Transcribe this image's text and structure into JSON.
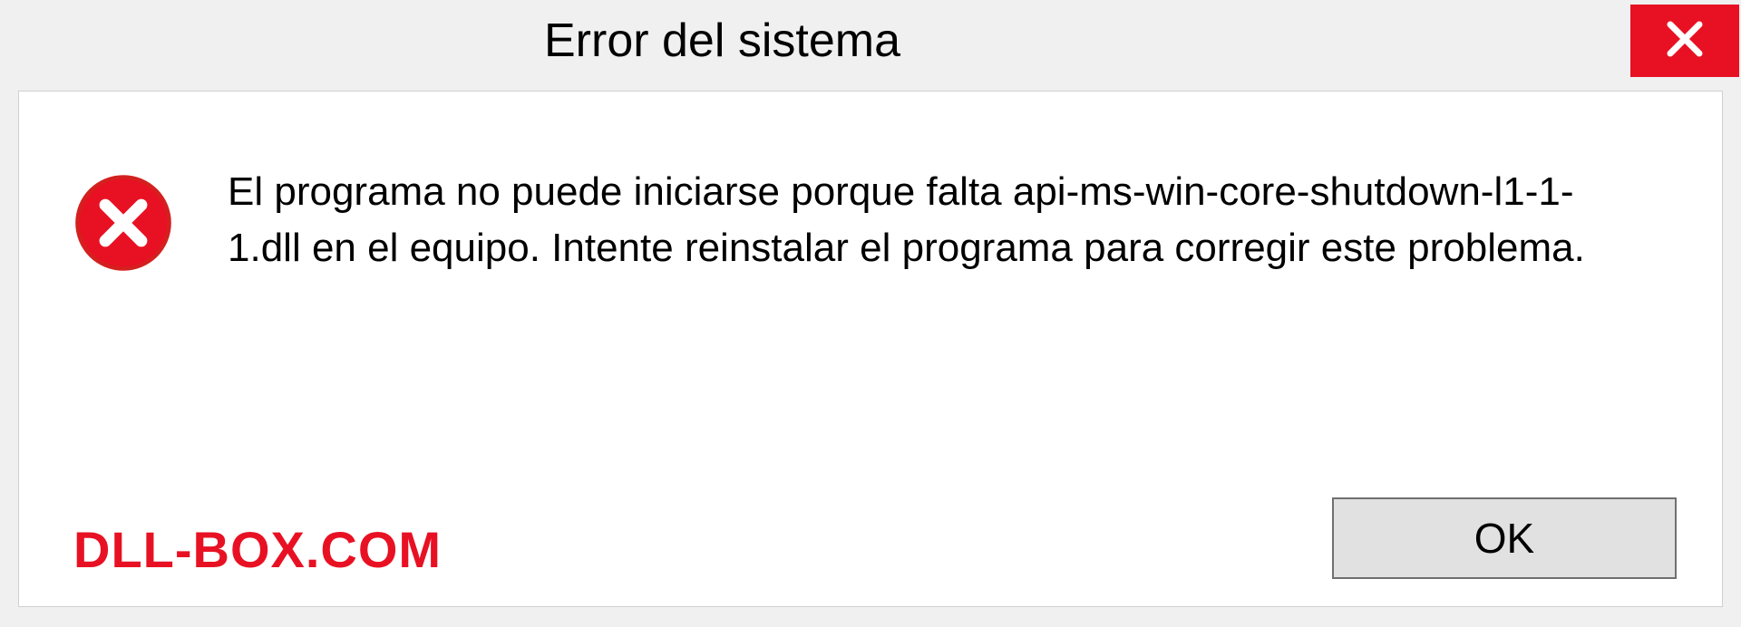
{
  "titlebar": {
    "title": "Error del sistema"
  },
  "message": {
    "text": "El programa no puede iniciarse porque falta api-ms-win-core-shutdown-l1-1-1.dll en el equipo. Intente reinstalar el programa para corregir este problema."
  },
  "buttons": {
    "ok_label": "OK"
  },
  "watermark": {
    "text": "DLL-BOX.COM"
  },
  "colors": {
    "close_red": "#e81123",
    "panel_bg": "#ffffff",
    "window_bg": "#f0f0f0"
  },
  "icons": {
    "close": "close-icon",
    "error": "error-circle-icon"
  }
}
